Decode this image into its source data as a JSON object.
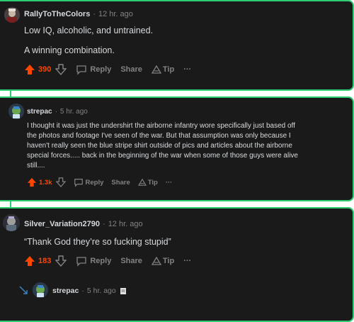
{
  "colors": {
    "accent": "#2ecc71",
    "upvote": "#ff4500",
    "bg": "#1a1a1b",
    "text": "#d7dadc",
    "muted": "#818384"
  },
  "comments": [
    {
      "username": "RallyToTheColors",
      "sep": "·",
      "time": "12 hr. ago",
      "lines": [
        "Low IQ, alcoholic, and untrained.",
        "A winning combination."
      ],
      "score": "390",
      "reply": "Reply",
      "share": "Share",
      "tip": "Tip",
      "more": "···"
    },
    {
      "username": "strepac",
      "sep": "·",
      "time": "5 hr. ago",
      "lines": [
        "I thought it was just the undershirt the airborne infantry wore specifically just based off",
        "the photos and footage I've seen of the war. But that assumption was only because I",
        "haven't really seen the blue stripe shirt outside of pics and articles about the airborne",
        "special forces..... back in the beginning of the war when some of those guys were alive",
        "still...."
      ],
      "score": "1.3k",
      "reply": "Reply",
      "share": "Share",
      "tip": "Tip",
      "more": "···"
    },
    {
      "username": "Silver_Variation2790",
      "sep": "·",
      "time": "12 hr. ago",
      "lines": [
        "“Thank God they’re so fucking stupid”"
      ],
      "score": "183",
      "reply": "Reply",
      "share": "Share",
      "tip": "Tip",
      "more": "···"
    }
  ],
  "collapsed_reply": {
    "username": "strepac",
    "sep": "·",
    "time": "5 hr. ago"
  }
}
